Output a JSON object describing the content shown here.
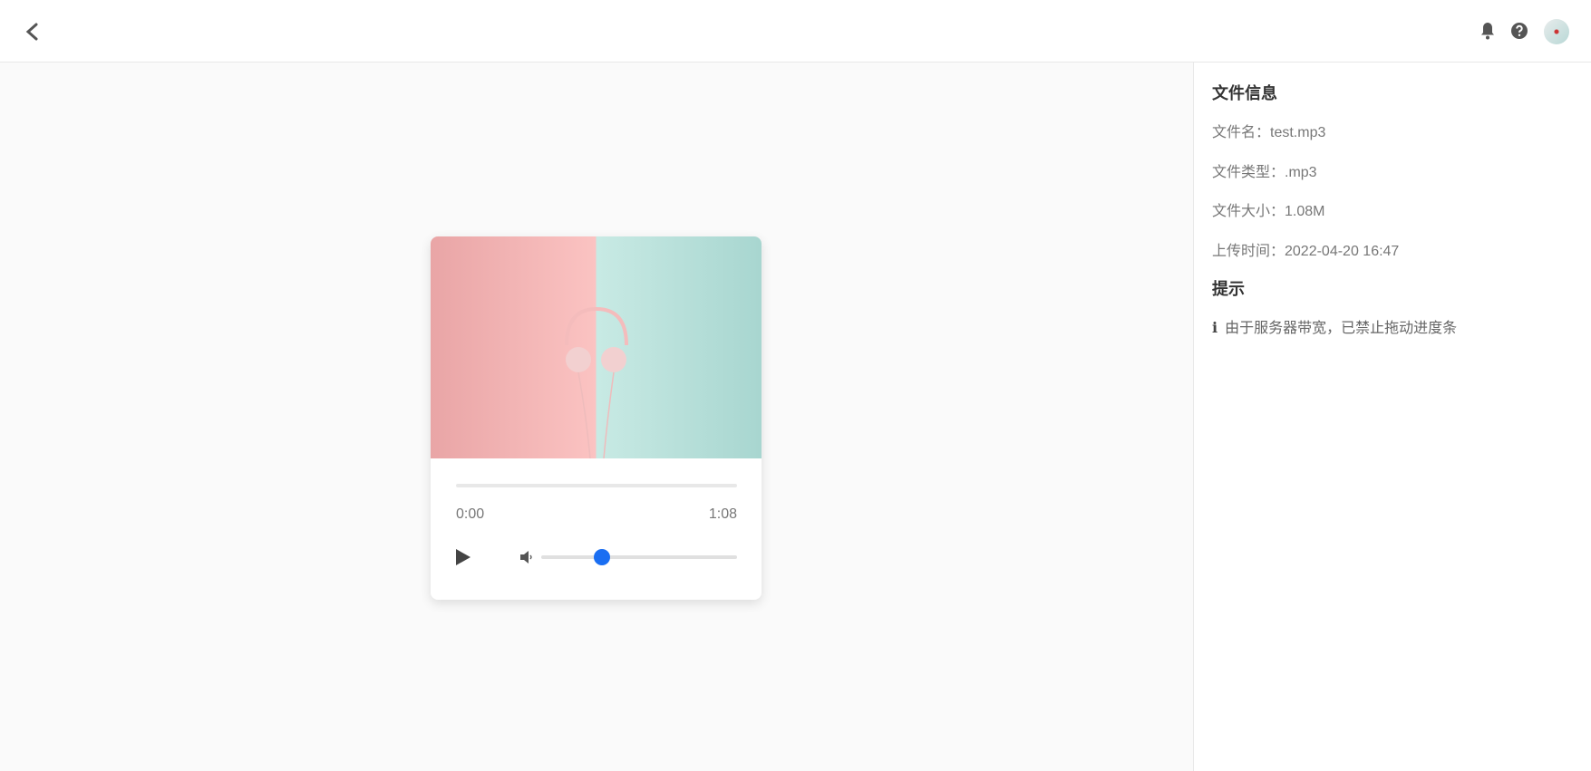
{
  "header": {
    "back_icon": "chevron-left-icon",
    "icons": [
      "bell-icon",
      "question-circle-icon",
      "avatar"
    ]
  },
  "player": {
    "current_time": "0:00",
    "duration": "1:08",
    "progress": 0,
    "volume_percent": 31,
    "accent_color": "#1a6ef2"
  },
  "sidebar": {
    "file_info_title": "文件信息",
    "file_name": "文件名：test.mp3",
    "file_type": "文件类型：.mp3",
    "file_size": "文件大小：1.08M",
    "upload_time": "上传时间：2022-04-20 16:47",
    "tip_title": "提示",
    "tip_text": "由于服务器带宽，已禁止拖动进度条"
  }
}
